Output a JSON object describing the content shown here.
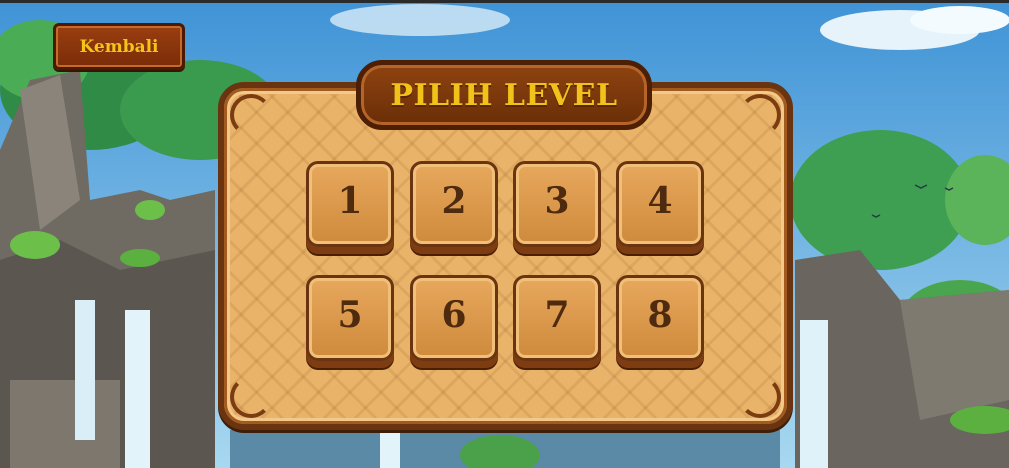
{
  "header": {
    "back_label": "Kembali"
  },
  "title": "PILIH LEVEL",
  "levels": [
    {
      "label": "1"
    },
    {
      "label": "2"
    },
    {
      "label": "3"
    },
    {
      "label": "4"
    },
    {
      "label": "5"
    },
    {
      "label": "6"
    },
    {
      "label": "7"
    },
    {
      "label": "8"
    }
  ],
  "colors": {
    "accent_text": "#f0c21a",
    "panel_fill": "#e9b46a",
    "panel_border": "#6b3410",
    "button_fill": "#d9974a",
    "number_text": "#4e2a0e"
  }
}
